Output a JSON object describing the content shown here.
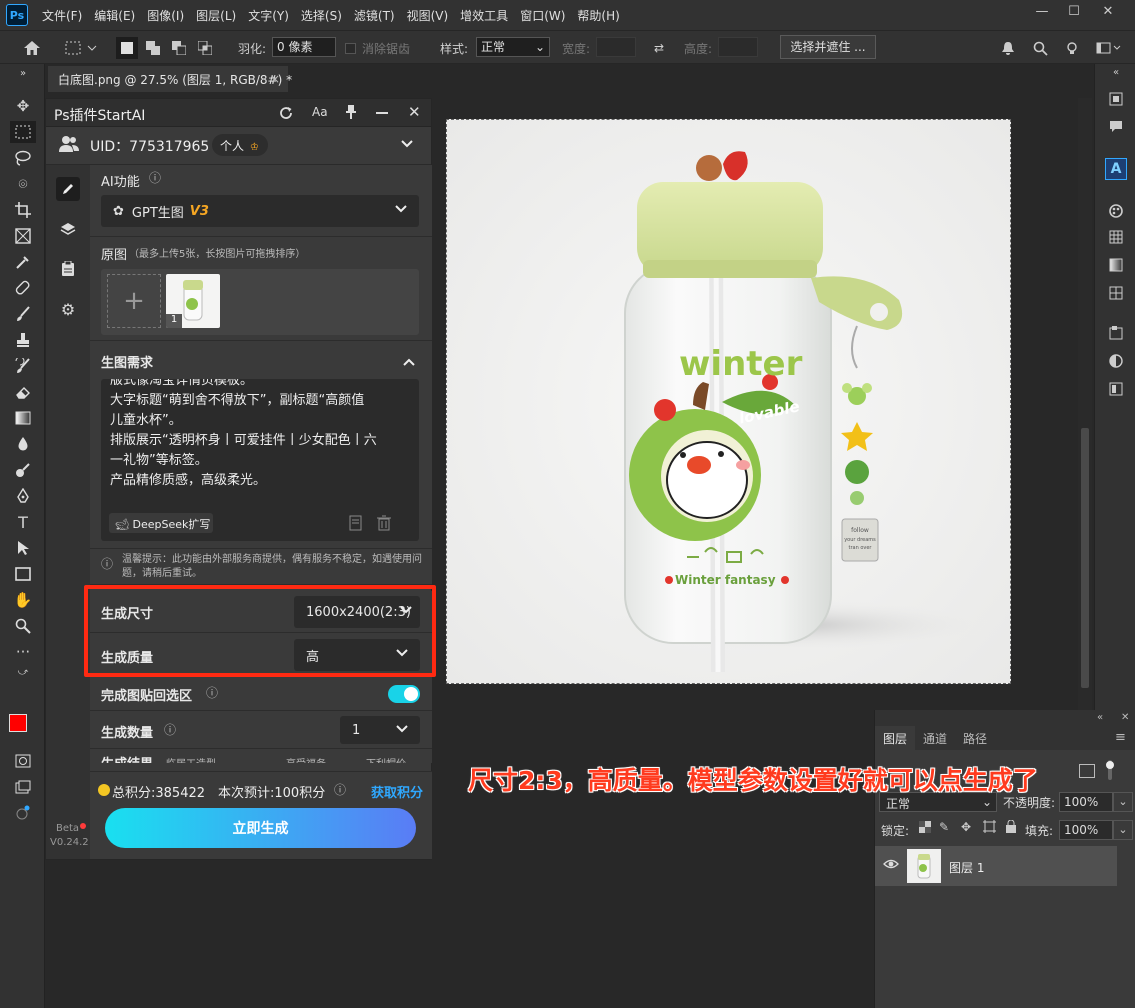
{
  "menubar": {
    "logo": "Ps",
    "items": [
      "文件(F)",
      "编辑(E)",
      "图像(I)",
      "图层(L)",
      "文字(Y)",
      "选择(S)",
      "滤镜(T)",
      "视图(V)",
      "增效工具",
      "窗口(W)",
      "帮助(H)"
    ],
    "minimize": "—",
    "maximize": "☐",
    "close": "✕"
  },
  "options": {
    "feather_label": "羽化:",
    "feather_value": "0 像素",
    "antialias_label": "消除锯齿",
    "style_label": "样式:",
    "style_value": "正常",
    "width_label": "宽度:",
    "height_label": "高度:",
    "select_mask_button": "选择并遮住 ..."
  },
  "document_tab": {
    "title": "白底图.png @ 27.5% (图层 1, RGB/8#) *",
    "close": "×"
  },
  "plugin": {
    "title": "Ps插件StartAI",
    "font_btn": "Aa",
    "uid_label": "UID：775317965",
    "account_type": "个人",
    "ai_function_label": "AI功能",
    "model_name": "GPT生图",
    "model_version": "V3",
    "source_label": "原图",
    "source_hint": "（最多上传5张，长按图片可拖拽排序）",
    "thumb_index": "1",
    "requirements_label": "生图需求",
    "requirements_lines": [
      "版式像淘宝详情页模板。",
      "大字标题“萌到舍不得放下”，副标题“高颜值",
      "儿童水杯”。",
      "排版展示“透明杯身丨可爱挂件丨少女配色丨六",
      "一礼物”等标签。",
      "产品精修质感，高级柔光。"
    ],
    "deepseek_button": "DeepSeek扩写",
    "notice": "温馨提示：此功能由外部服务商提供，偶有服务不稳定，如遇使用问题，请稍后重试。",
    "size_label": "生成尺寸",
    "size_value": "1600x2400(2:3)",
    "quality_label": "生成质量",
    "quality_value": "高",
    "paste_back_label": "完成图贴回选区",
    "count_label": "生成数量",
    "count_value": "1",
    "result_label": "生成结果",
    "result_opt1": "临居工造型",
    "result_opt2": "享受福务",
    "result_opt3": "下利帽价",
    "points_total": "总积分:385422",
    "points_estimate": "本次预计:100积分",
    "get_points": "获取积分",
    "generate_button": "立即生成",
    "beta": "Beta",
    "version": "V0.24.2"
  },
  "product_image": {
    "text_winter": "winter",
    "text_lovable": "lovable",
    "text_fantasy": "Winter fantasy",
    "tag_line1": "follow",
    "tag_line2": "your dreams",
    "tag_line3": "tran over"
  },
  "layers": {
    "tabs": [
      "图层",
      "通道",
      "路径"
    ],
    "blend_mode": "正常",
    "opacity_label": "不透明度:",
    "opacity_value": "100%",
    "lock_label": "锁定:",
    "fill_label": "填充:",
    "fill_value": "100%",
    "layer_name": "图层 1"
  },
  "annotation": "尺寸2:3，高质量。模型参数设置好就可以点生成了",
  "colors": {
    "accent_red": "#ff2a12",
    "generate_start": "#19e0f0",
    "generate_end": "#5a7cf5",
    "toggle_on": "#19d3e8",
    "get_points": "#2fa8ff",
    "v3_gold": "#f5a623"
  }
}
